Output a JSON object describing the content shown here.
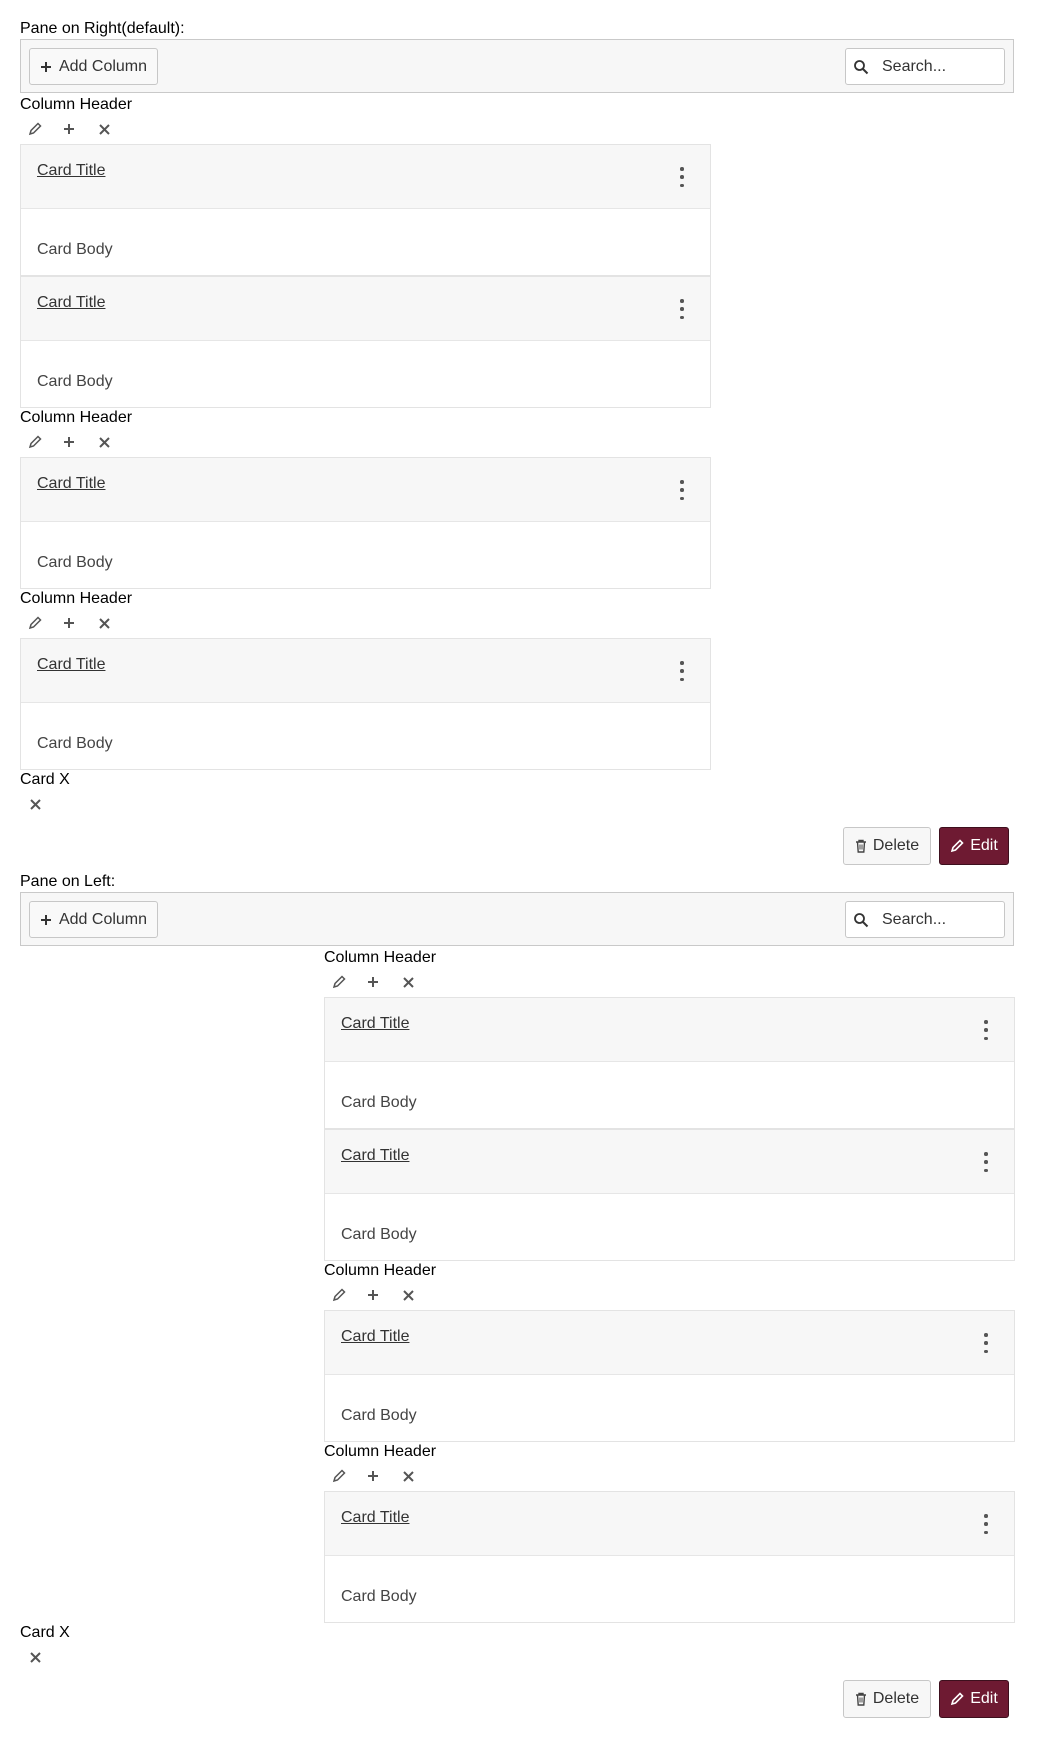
{
  "sections": [
    {
      "label": "Pane on Right(default):",
      "add_column_label": "Add Column",
      "search_placeholder": "Search...",
      "columns": [
        {
          "header": "Column Header",
          "cards": [
            {
              "title": "Card Title",
              "body": "Card Body"
            },
            {
              "title": "Card Title",
              "body": "Card Body"
            }
          ]
        },
        {
          "header": "Column Header",
          "cards": [
            {
              "title": "Card Title",
              "body": "Card Body"
            }
          ]
        },
        {
          "header": "Column Header",
          "cards": [
            {
              "title": "Card Title",
              "body": "Card Body"
            }
          ]
        }
      ],
      "card_pane_title": "Card X",
      "delete_label": "Delete",
      "edit_label": "Edit"
    },
    {
      "label": "Pane on Left:",
      "add_column_label": "Add Column",
      "search_placeholder": "Search...",
      "columns": [
        {
          "header": "Column Header",
          "cards": [
            {
              "title": "Card Title",
              "body": "Card Body"
            },
            {
              "title": "Card Title",
              "body": "Card Body"
            }
          ]
        },
        {
          "header": "Column Header",
          "cards": [
            {
              "title": "Card Title",
              "body": "Card Body"
            }
          ]
        },
        {
          "header": "Column Header",
          "cards": [
            {
              "title": "Card Title",
              "body": "Card Body"
            }
          ]
        }
      ],
      "card_pane_title": "Card X",
      "delete_label": "Delete",
      "edit_label": "Edit"
    }
  ],
  "colors": {
    "edit_button_bg": "#6e1a32",
    "toolbar_bg": "#f7f7f7",
    "card_header_bg": "#f7f7f7"
  },
  "icons": [
    "plus-icon",
    "search-icon",
    "pencil-icon",
    "close-icon",
    "kebab-menu-icon",
    "trash-icon"
  ]
}
